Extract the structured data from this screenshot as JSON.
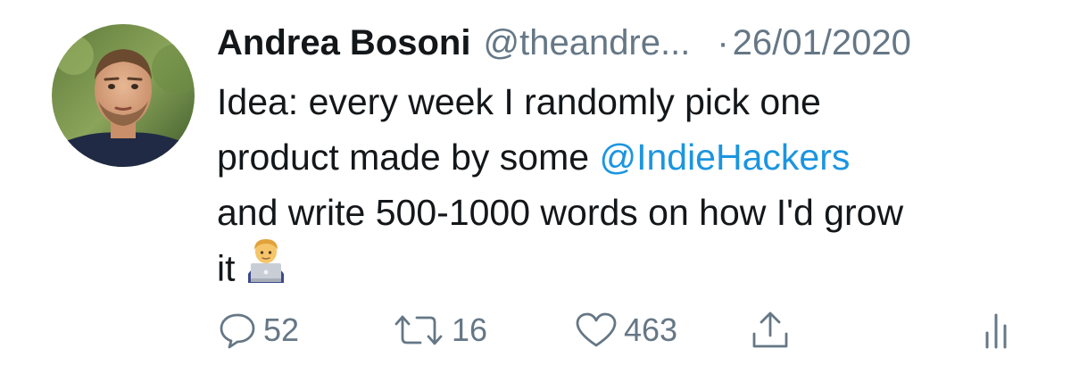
{
  "tweet": {
    "author_name": "Andrea Bosoni",
    "author_handle": "@theandre...",
    "separator": "·",
    "date": "26/01/2020",
    "text": {
      "line1": "Idea: every week I randomly pick one",
      "line2_prefix": "product made by some ",
      "mention": "@IndieHackers",
      "line3": "and write 500-1000 words on how I'd grow",
      "line4": "it"
    },
    "emoji": "man-technologist-icon"
  },
  "actions": {
    "reply_count": "52",
    "retweet_count": "16",
    "like_count": "463"
  },
  "colors": {
    "text": "#14171a",
    "muted": "#657786",
    "link": "#1b95e0"
  }
}
